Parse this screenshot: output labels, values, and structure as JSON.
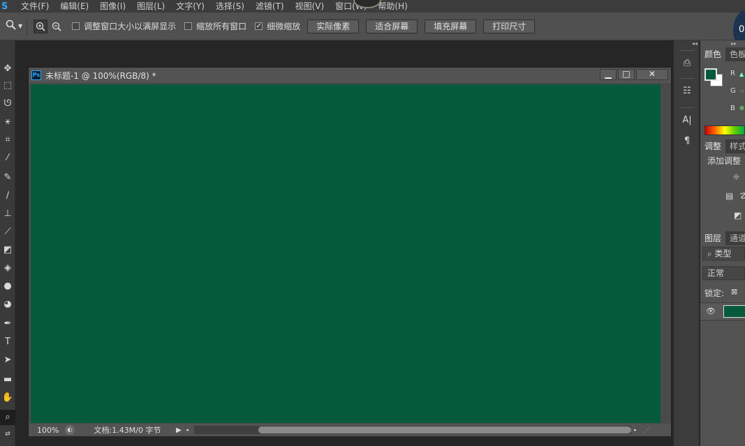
{
  "app": {
    "logo": "S"
  },
  "menu": [
    "文件(F)",
    "编辑(E)",
    "图像(I)",
    "图层(L)",
    "文字(Y)",
    "选择(S)",
    "滤镜(T)",
    "视图(V)",
    "窗口(W)",
    "帮助(H)"
  ],
  "badge": "0",
  "options": {
    "tool_icon": "zoom-tool-icon",
    "checkbox_resize_windows": {
      "label": "调整窗口大小以满屏显示",
      "checked": false
    },
    "checkbox_zoom_all": {
      "label": "缩放所有窗口",
      "checked": false
    },
    "checkbox_scrubby_zoom": {
      "label": "细微缩放",
      "checked": true,
      "mark": "✓"
    },
    "buttons": [
      "实际像素",
      "适合屏幕",
      "填充屏幕",
      "打印尺寸"
    ]
  },
  "document": {
    "title": "未标题-1 @ 100%(RGB/8) *",
    "icon_text": "Ps",
    "canvas_color": "#045a3a",
    "status": {
      "zoom": "100%",
      "info": "文档:1.43M/0 字节"
    },
    "window_buttons": {
      "minimize": "▁",
      "maximize": "□",
      "close": "✕"
    }
  },
  "panels": {
    "color": {
      "tabs": [
        "颜色",
        "色板"
      ],
      "foreground": "#045a3a",
      "background": "#ffffff",
      "channels": [
        "R",
        "G",
        "B"
      ]
    },
    "adjustments": {
      "tabs": [
        "调整",
        "样式"
      ],
      "add_label": "添加调整"
    },
    "layers": {
      "tabs": [
        "图层",
        "通道"
      ],
      "filter_label": "类型",
      "blend_mode": "正常",
      "lock_label": "锁定:"
    }
  }
}
